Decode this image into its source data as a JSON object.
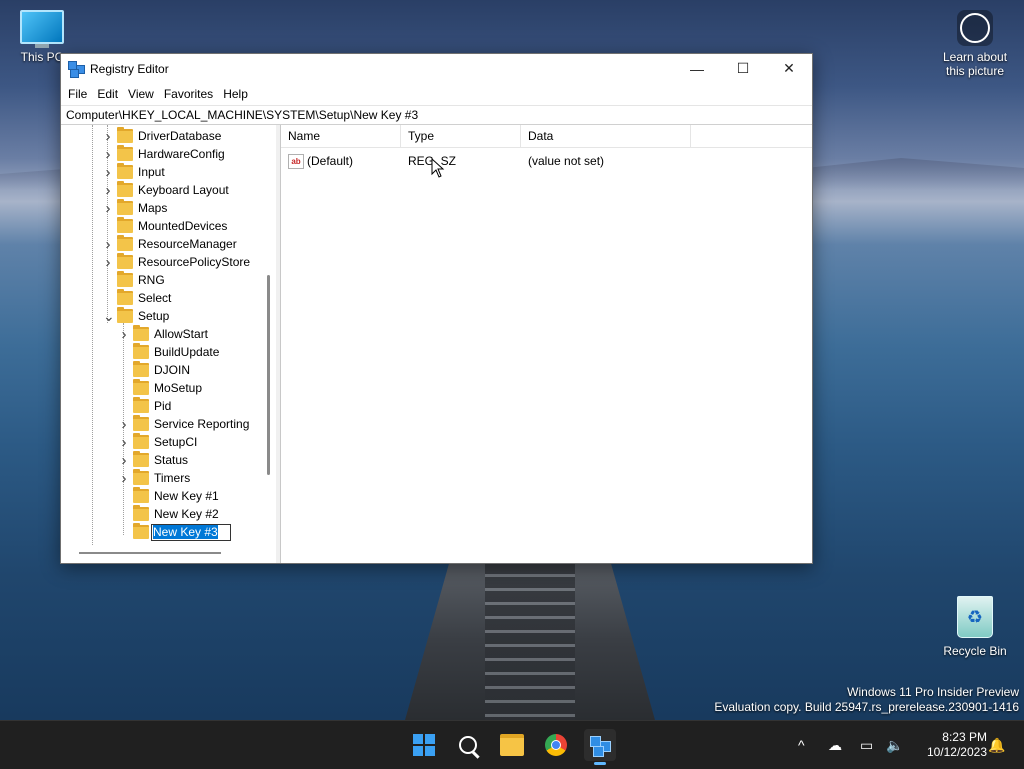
{
  "desktop": {
    "this_pc_label": "This PC",
    "learn_label": "Learn about this picture",
    "recycle_label": "Recycle Bin",
    "watermark_line1": "Windows 11 Pro Insider Preview",
    "watermark_line2": "Evaluation copy. Build 25947.rs_prerelease.230901-1416"
  },
  "window": {
    "title": "Registry Editor",
    "minimize_glyph": "—",
    "maximize_glyph": "☐",
    "close_glyph": "✕",
    "menu": [
      "File",
      "Edit",
      "View",
      "Favorites",
      "Help"
    ],
    "address": "Computer\\HKEY_LOCAL_MACHINE\\SYSTEM\\Setup\\New Key #3"
  },
  "tree": {
    "items": [
      {
        "label": "DriverDatabase",
        "level": 1,
        "expander": ">"
      },
      {
        "label": "HardwareConfig",
        "level": 1,
        "expander": ">"
      },
      {
        "label": "Input",
        "level": 1,
        "expander": ">"
      },
      {
        "label": "Keyboard Layout",
        "level": 1,
        "expander": ">"
      },
      {
        "label": "Maps",
        "level": 1,
        "expander": ">"
      },
      {
        "label": "MountedDevices",
        "level": 1,
        "expander": ""
      },
      {
        "label": "ResourceManager",
        "level": 1,
        "expander": ">"
      },
      {
        "label": "ResourcePolicyStore",
        "level": 1,
        "expander": ">"
      },
      {
        "label": "RNG",
        "level": 1,
        "expander": ""
      },
      {
        "label": "Select",
        "level": 1,
        "expander": ""
      },
      {
        "label": "Setup",
        "level": 1,
        "expander": "v"
      },
      {
        "label": "AllowStart",
        "level": 2,
        "expander": ">"
      },
      {
        "label": "BuildUpdate",
        "level": 2,
        "expander": ""
      },
      {
        "label": "DJOIN",
        "level": 2,
        "expander": ""
      },
      {
        "label": "MoSetup",
        "level": 2,
        "expander": ""
      },
      {
        "label": "Pid",
        "level": 2,
        "expander": ""
      },
      {
        "label": "Service Reporting",
        "level": 2,
        "expander": ">"
      },
      {
        "label": "SetupCI",
        "level": 2,
        "expander": ">"
      },
      {
        "label": "Status",
        "level": 2,
        "expander": ">"
      },
      {
        "label": "Timers",
        "level": 2,
        "expander": ">"
      },
      {
        "label": "New Key #1",
        "level": 2,
        "expander": ""
      },
      {
        "label": "New Key #2",
        "level": 2,
        "expander": ""
      }
    ],
    "editing_label": "New Key #3"
  },
  "list": {
    "columns": [
      "Name",
      "Type",
      "Data"
    ],
    "rows": [
      {
        "name": "(Default)",
        "type": "REG_SZ",
        "data": "(value not set)",
        "icon_text": "ab"
      }
    ]
  },
  "taskbar": {
    "clock_time": "8:23 PM",
    "clock_date": "10/12/2023",
    "tray_chevron": "^"
  },
  "icons": {
    "start": "windows-start-icon",
    "search": "search-icon",
    "explorer": "file-explorer-icon",
    "chrome": "chrome-icon",
    "regedit": "registry-editor-icon"
  }
}
